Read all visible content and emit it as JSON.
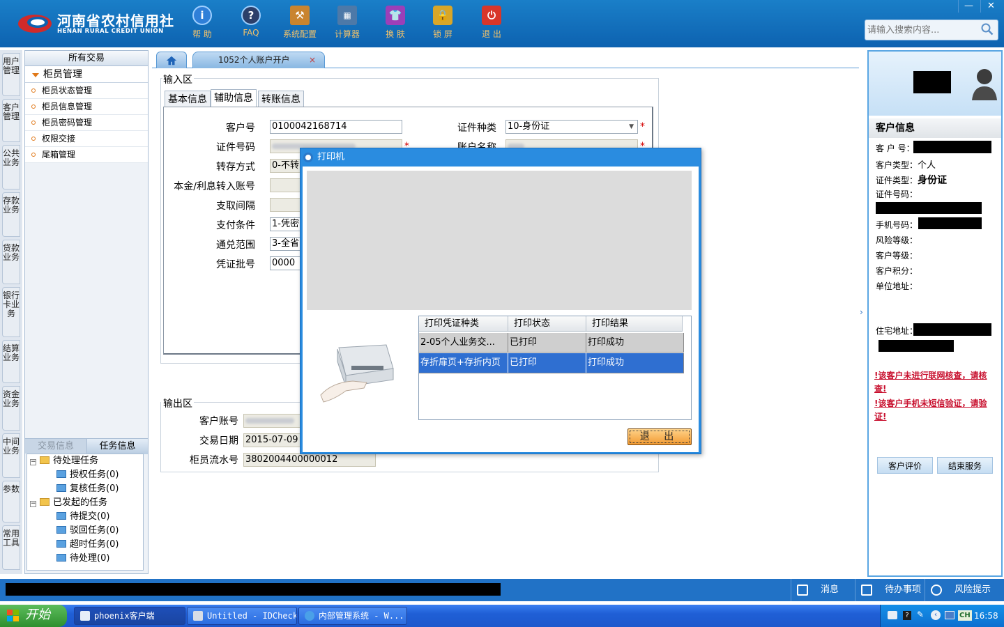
{
  "header": {
    "logo_cn": "河南省农村信用社",
    "logo_en": "HENAN RURAL CREDIT UNION",
    "tools": [
      {
        "label": "帮 助",
        "icon": "info-icon"
      },
      {
        "label": "FAQ",
        "icon": "question-icon"
      },
      {
        "label": "系统配置",
        "icon": "toolbox-icon"
      },
      {
        "label": "计算器",
        "icon": "calculator-icon"
      },
      {
        "label": "换 肤",
        "icon": "shirt-icon"
      },
      {
        "label": "锁 屏",
        "icon": "lock-icon"
      },
      {
        "label": "退 出",
        "icon": "power-icon"
      }
    ],
    "search_placeholder": "请输入搜索内容...",
    "win_min": "—",
    "win_close": "✕"
  },
  "vtabs": [
    "用户管理",
    "客户管理",
    "公共业务",
    "存款业务",
    "贷款业务",
    "银行卡业务",
    "结算业务",
    "资金业务",
    "中间业务",
    "参数",
    "常用工具"
  ],
  "left": {
    "head": "所有交易",
    "group": "柜员管理",
    "items": [
      "柜员状态管理",
      "柜员信息管理",
      "柜员密码管理",
      "权限交接",
      "尾箱管理"
    ],
    "tab_trade": "交易信息",
    "tab_task": "任务信息",
    "tree": {
      "pending": "待处理任务",
      "auth": "授权任务(0)",
      "review": "复核任务(0)",
      "initiated": "已发起的任务",
      "to_submit": "待提交(0)",
      "rejected": "驳回任务(0)",
      "timeout": "超时任务(0)",
      "to_process": "待处理(0)"
    }
  },
  "tabs": {
    "active": "1052个人账户开户",
    "close": "×"
  },
  "input_area": {
    "title": "输入区",
    "tabs": [
      "基本信息",
      "辅助信息",
      "转账信息"
    ],
    "customer_no_label": "客户号",
    "customer_no": "0100042168714",
    "id_type_label": "证件种类",
    "id_type": "10-身份证",
    "id_no_label": "证件号码",
    "acct_name_label": "账户名称",
    "transfer_mode_label": "转存方式",
    "transfer_mode": "0-不转",
    "interest_acct_label": "本金/利息转入账号",
    "withdraw_interval_label": "支取间隔",
    "pay_cond_label": "支付条件",
    "pay_cond": "1-凭密",
    "exchange_range_label": "通兑范围",
    "exchange_range": "3-全省",
    "voucher_batch_label": "凭证批号",
    "voucher_batch": "0000",
    "required": "*"
  },
  "output_area": {
    "title": "输出区",
    "acct_label": "客户账号",
    "date_label": "交易日期",
    "date": "2015-07-09",
    "serial_label": "柜员流水号",
    "serial": "3802004400000012"
  },
  "dialog": {
    "title": "打印机",
    "columns": [
      "打印凭证种类",
      "打印状态",
      "打印结果"
    ],
    "rows": [
      [
        "2-05个人业务交...",
        "已打印",
        "打印成功"
      ],
      [
        "存折扉页+存折内页",
        "已打印",
        "打印成功"
      ]
    ],
    "exit": "退 出"
  },
  "customer": {
    "head": "客户信息",
    "no_label": "客 户 号：",
    "type_label": "客户类型：",
    "type": "个人",
    "idtype_label": "证件类型：",
    "idtype": "身份证",
    "idno_label": "证件号码：",
    "phone_label": "手机号码：",
    "risk_label": "风险等级：",
    "level_label": "客户等级：",
    "points_label": "客户积分：",
    "work_label": "单位地址：",
    "home_label": "住宅地址：",
    "warn1": "!该客户未进行联网核查，请核查!",
    "warn2": "!该客户手机未短信验证，请验证!",
    "eval_btn": "客户评价",
    "end_btn": "结束服务"
  },
  "status": {
    "msg": "消息",
    "todo": "待办事项",
    "risk": "风险提示"
  },
  "taskbar": {
    "start": "开始",
    "apps": [
      "phoenix客户端",
      "Untitled - IDCheck",
      "内部管理系统 - W..."
    ],
    "tray_lang": "CH",
    "time": "16:58"
  },
  "colors": {
    "header_blue": "#0d62b0",
    "selected_row": "#2f6fd1",
    "warning_red": "#c8102e"
  }
}
